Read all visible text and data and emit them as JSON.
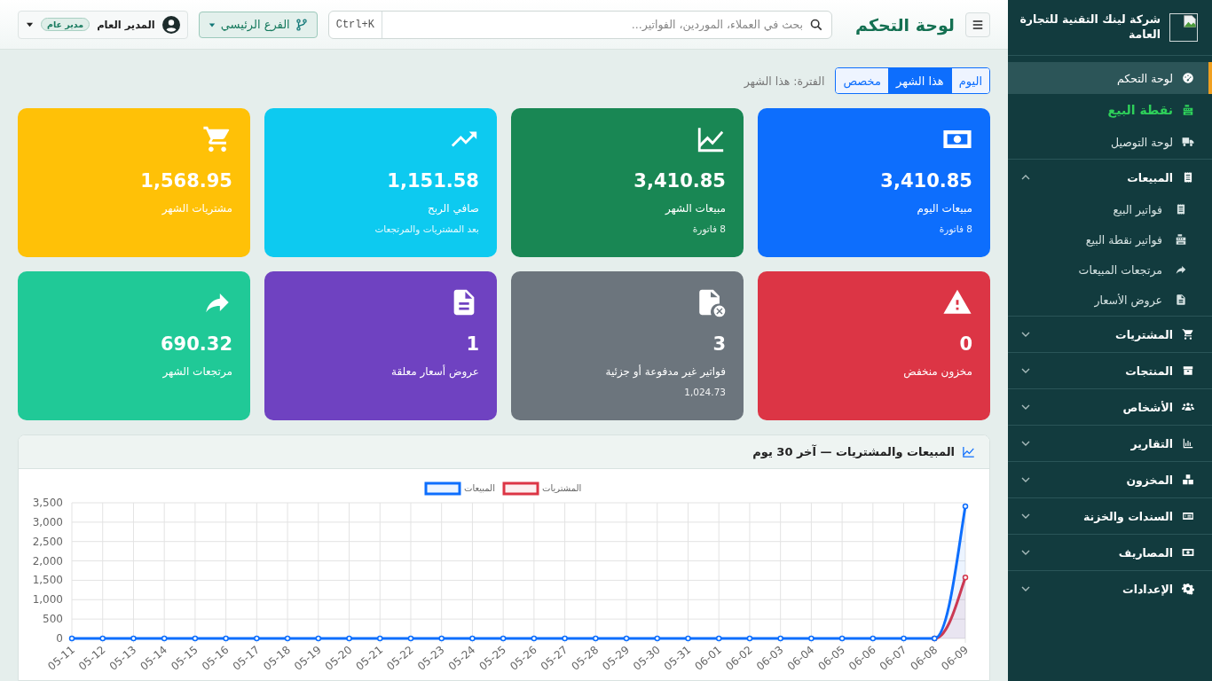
{
  "sidebar": {
    "brand": "شركة لينك التقنية للتجارة العامة",
    "items": [
      {
        "label": "لوحة التحكم",
        "kind": "link",
        "selected": true,
        "accent": false
      },
      {
        "label": "نقطة البيع",
        "kind": "link",
        "selected": false,
        "accent": true
      },
      {
        "label": "لوحة التوصيل",
        "kind": "link",
        "selected": false,
        "accent": false
      },
      {
        "label": "المبيعات",
        "kind": "group",
        "selected": false,
        "expanded": true,
        "children": [
          {
            "label": "فواتير البيع",
            "selected": false
          },
          {
            "label": "فواتير نقطة البيع",
            "selected": false
          },
          {
            "label": "مرتجعات المبيعات",
            "selected": false
          },
          {
            "label": "عروض الأسعار",
            "selected": false
          }
        ]
      },
      {
        "label": "المشتريات",
        "kind": "group",
        "selected": false,
        "expanded": false
      },
      {
        "label": "المنتجات",
        "kind": "group",
        "selected": false,
        "expanded": false
      },
      {
        "label": "الأشخاص",
        "kind": "group",
        "selected": false,
        "expanded": false
      },
      {
        "label": "التقارير",
        "kind": "group",
        "selected": false,
        "expanded": false
      },
      {
        "label": "المخزون",
        "kind": "group",
        "selected": false,
        "expanded": false
      },
      {
        "label": "السندات والخزنة",
        "kind": "group",
        "selected": false,
        "expanded": false
      },
      {
        "label": "المصاريف",
        "kind": "group",
        "selected": false,
        "expanded": false
      },
      {
        "label": "الإعدادات",
        "kind": "group",
        "selected": false,
        "expanded": false
      }
    ]
  },
  "topbar": {
    "title": "لوحة التحكم",
    "search": {
      "placeholder": "بحث في العملاء، الموردين، الفواتير...",
      "shortcut": "Ctrl+K"
    },
    "branch": "الفرع الرئيسي",
    "user": {
      "name": "المدير العام",
      "role": "مدير عام"
    }
  },
  "period": {
    "label": "الفترة: هذا الشهر",
    "options": [
      {
        "label": "اليوم",
        "selected": false
      },
      {
        "label": "هذا الشهر",
        "selected": true
      },
      {
        "label": "مخصص",
        "selected": false
      }
    ]
  },
  "cards": [
    {
      "value": "3,410.85",
      "label": "مبيعات اليوم",
      "sub": "8 فاتورة",
      "color": "#0d6efd"
    },
    {
      "value": "3,410.85",
      "label": "مبيعات الشهر",
      "sub": "8 فاتورة",
      "color": "#198754"
    },
    {
      "value": "1,151.58",
      "label": "صافي الربح",
      "sub": "بعد المشتريات والمرتجعات",
      "color": "#0dcaf0"
    },
    {
      "value": "1,568.95",
      "label": "مشتريات الشهر",
      "color": "#ffc107"
    },
    {
      "value": "0",
      "label": "مخزون منخفض",
      "color": "#dc3545"
    },
    {
      "value": "3",
      "label": "فواتير غير مدفوعة أو جزئية",
      "sub": "1,024.73",
      "color": "#6c757d"
    },
    {
      "value": "1",
      "label": "عروض أسعار معلقة",
      "color": "#6f42c1"
    },
    {
      "value": "690.32",
      "label": "مرتجعات الشهر",
      "color": "#20c997"
    }
  ],
  "chart_panel": {
    "chart_data": {
      "type": "line",
      "title": "المبيعات والمشتريات — آخر 30 يوم",
      "categories": [
        "05-11",
        "05-12",
        "05-13",
        "05-14",
        "05-15",
        "05-16",
        "05-17",
        "05-18",
        "05-19",
        "05-20",
        "05-21",
        "05-22",
        "05-23",
        "05-24",
        "05-25",
        "05-26",
        "05-27",
        "05-28",
        "05-29",
        "05-30",
        "05-31",
        "06-01",
        "06-02",
        "06-03",
        "06-04",
        "06-05",
        "06-06",
        "06-07",
        "06-08",
        "06-09"
      ],
      "series": [
        {
          "name": "المبيعات",
          "color": "#0d6efd",
          "marker": true,
          "values": [
            0,
            0,
            0,
            0,
            0,
            0,
            0,
            0,
            0,
            0,
            0,
            0,
            0,
            0,
            0,
            0,
            0,
            0,
            0,
            0,
            0,
            0,
            0,
            0,
            0,
            0,
            0,
            0,
            0,
            3410
          ]
        },
        {
          "name": "المشتريات",
          "color": "#dc3545",
          "marker": true,
          "values": [
            null,
            null,
            null,
            null,
            null,
            null,
            null,
            null,
            null,
            null,
            null,
            null,
            null,
            null,
            null,
            null,
            null,
            null,
            null,
            null,
            null,
            null,
            null,
            null,
            null,
            null,
            null,
            null,
            0,
            1570
          ]
        }
      ],
      "grid": true,
      "legend": true,
      "ylim": [
        0,
        3500
      ],
      "yticks": [
        {
          "value": 0,
          "label": "0"
        },
        {
          "value": 500,
          "label": "500"
        },
        {
          "value": 1000,
          "label": "1,000"
        },
        {
          "value": 1500,
          "label": "1,500"
        },
        {
          "value": 2000,
          "label": "2,000"
        },
        {
          "value": 2500,
          "label": "2,500"
        },
        {
          "value": 3000,
          "label": "3,000"
        },
        {
          "value": 3500,
          "label": "3,500"
        }
      ]
    }
  }
}
